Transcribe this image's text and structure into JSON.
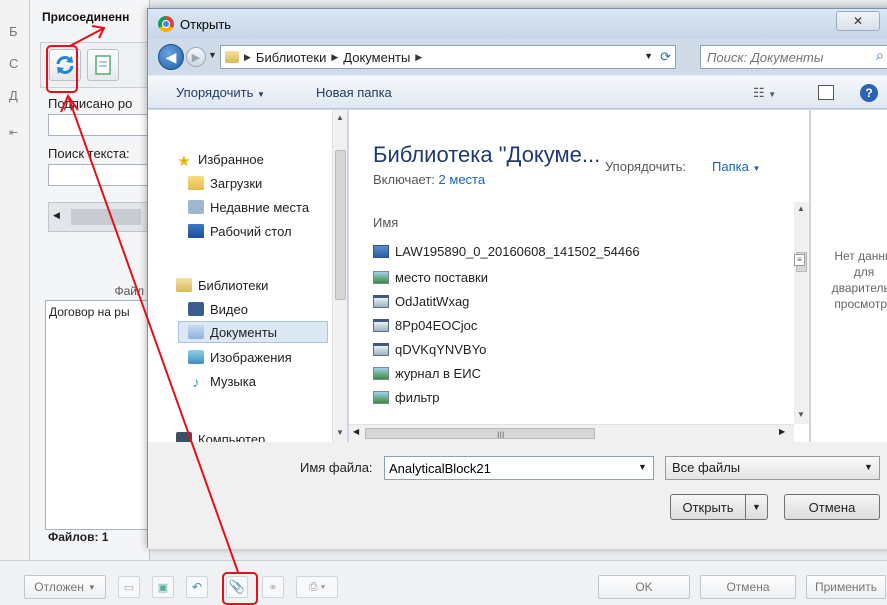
{
  "background": {
    "window_title": "Присоединенн",
    "side_letters": [
      "Б",
      "С",
      "Д"
    ],
    "signed_label": "Подписано ро",
    "search_text_label": "Поиск текста:",
    "files_column": "Файл",
    "list_items": [
      "Договор на ры"
    ],
    "files_count": "Файлов: 1",
    "bottom_bar": {
      "deferred_label": "Отложен",
      "ok_label": "OK",
      "cancel_label": "Отмена",
      "apply_label": "Применить"
    }
  },
  "dialog": {
    "title": "Открыть",
    "close_glyph": "✕",
    "address": {
      "segments": [
        "Библиотеки",
        "Документы"
      ]
    },
    "search_placeholder": "Поиск: Документы",
    "commands": {
      "organize": "Упорядочить",
      "new_folder": "Новая папка"
    },
    "nav": {
      "favorites": "Избранное",
      "downloads": "Загрузки",
      "recent": "Недавние места",
      "desktop": "Рабочий стол",
      "libraries": "Библиотеки",
      "video": "Видео",
      "documents": "Документы",
      "pictures": "Изображения",
      "music": "Музыка",
      "computer": "Компьютер"
    },
    "library": {
      "title": "Библиотека \"Докуме...",
      "includes_label": "Включает:",
      "includes_link": "2 места",
      "arrange_label": "Упорядочить:",
      "arrange_value": "Папка",
      "column_name": "Имя"
    },
    "files": [
      {
        "name": "LAW195890_0_20160608_141502_54466",
        "icon": "word-doc-icon"
      },
      {
        "name": "место поставки",
        "icon": "image-file-icon"
      },
      {
        "name": "OdJatitWxag",
        "icon": "window-file-icon"
      },
      {
        "name": "8Pp04EOCjoc",
        "icon": "window-file-icon"
      },
      {
        "name": "qDVKqYNVBYo",
        "icon": "window-file-icon"
      },
      {
        "name": "журнал в ЕИС",
        "icon": "image-file-icon"
      },
      {
        "name": "фильтр",
        "icon": "image-file-icon"
      }
    ],
    "preview_text": "Нет данны\nдля\nдварительн\nпросмотра",
    "file_name_label": "Имя файла:",
    "file_name_value": "AnalyticalBlock21",
    "filter_value": "Все файлы",
    "open_label": "Открыть",
    "cancel_label": "Отмена"
  },
  "colors": {
    "annotation_red": "#e2101a",
    "link_blue": "#1565c0",
    "title_blue": "#1e3a6e"
  }
}
